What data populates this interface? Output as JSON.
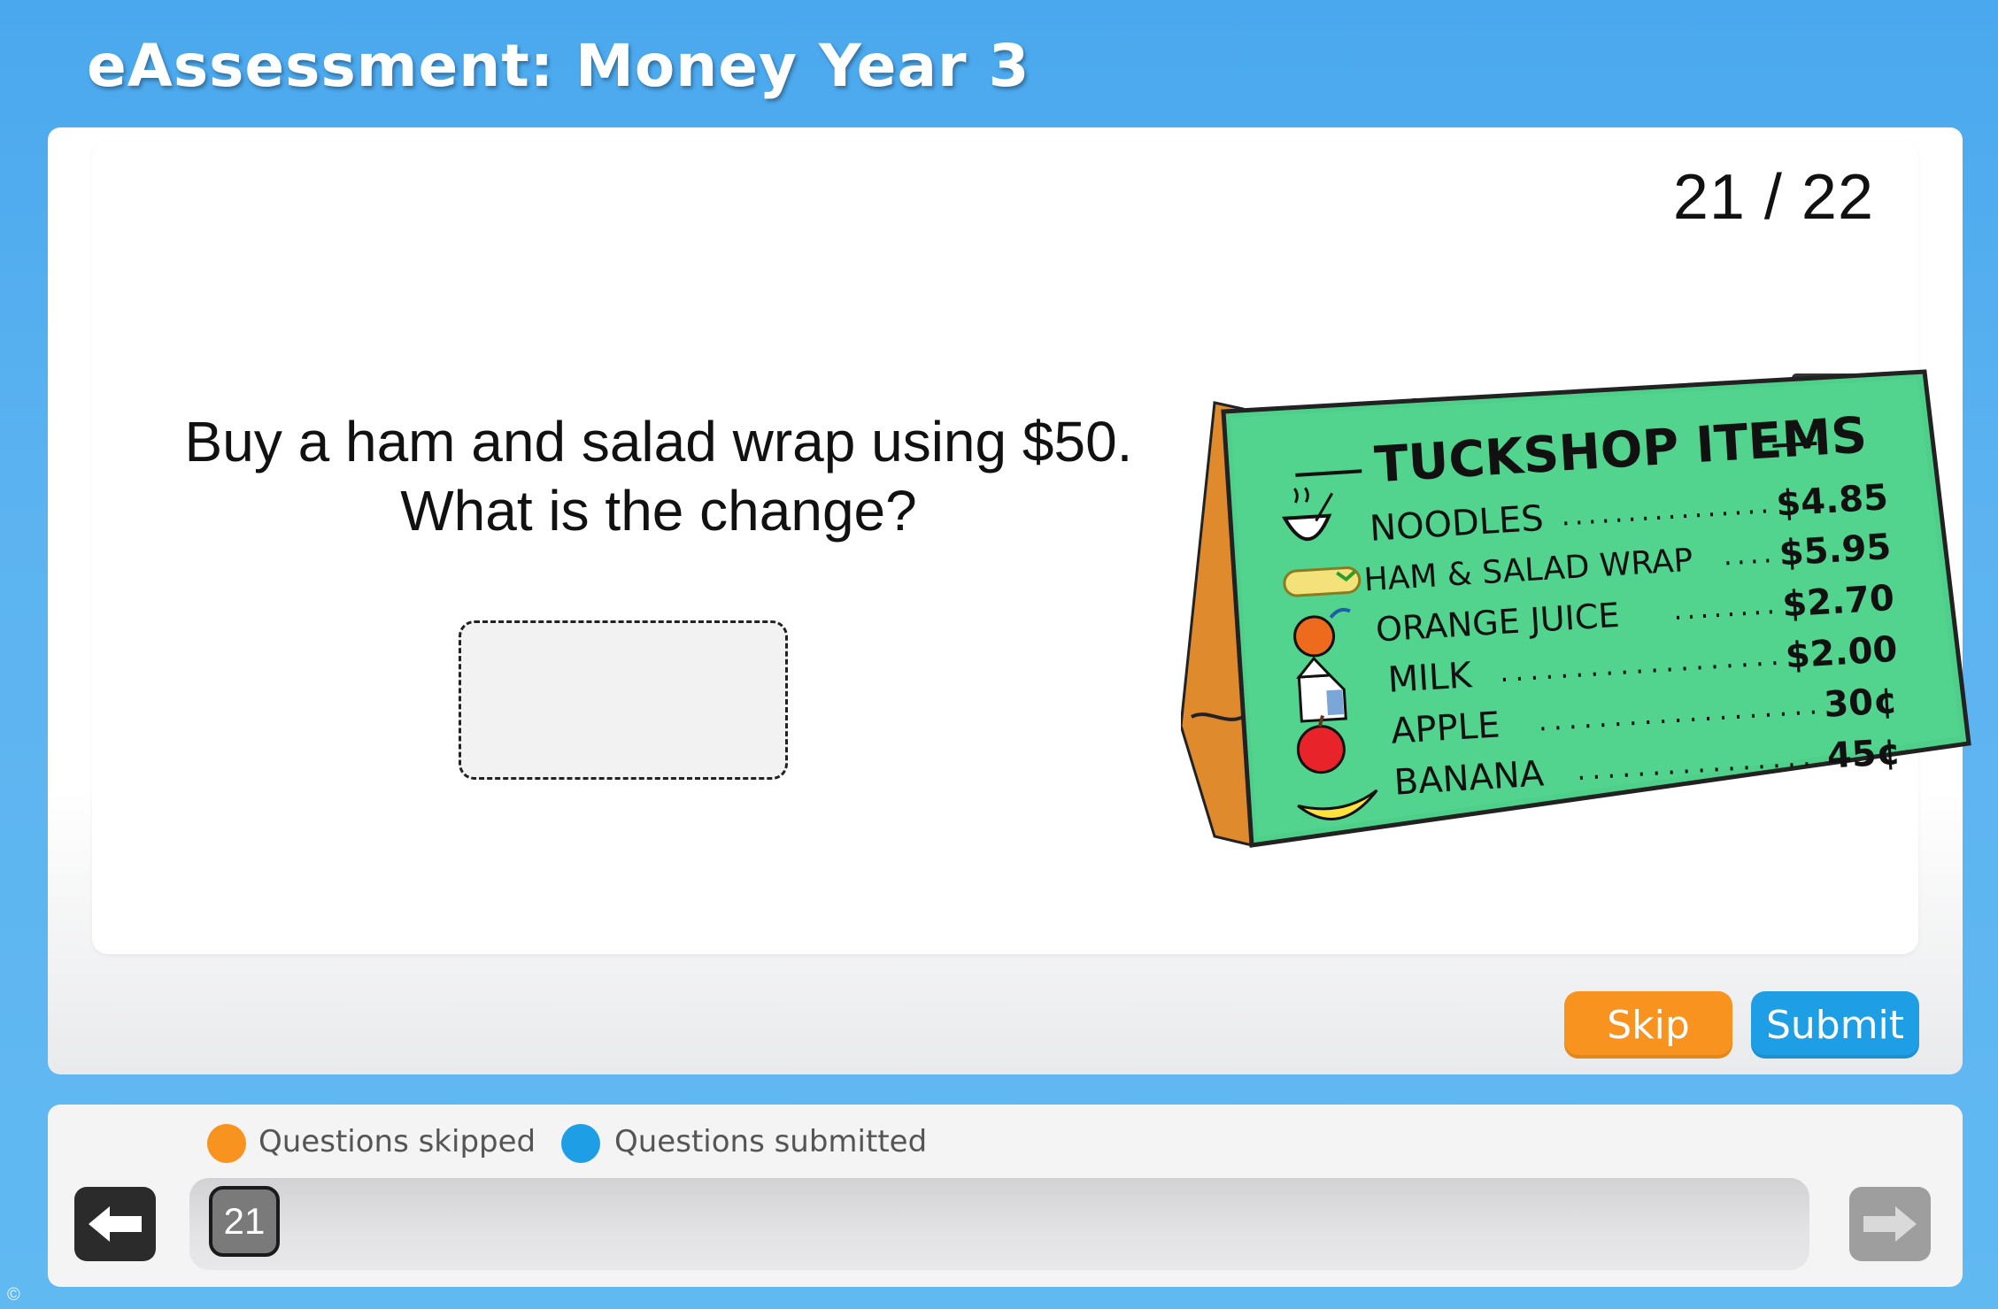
{
  "app": {
    "title": "eAssessment: Money Year 3"
  },
  "question": {
    "counter": "21 / 22",
    "line1": "Buy a ham and salad wrap using $50.",
    "line2": "What is the change?",
    "answer_value": ""
  },
  "tuckshop": {
    "heading": "TUCKSHOP ITEMS",
    "items": [
      {
        "name": "NOODLES",
        "price": "$4.85",
        "icon": "noodles-bowl-icon"
      },
      {
        "name": "HAM & SALAD WRAP",
        "price": "$5.95",
        "icon": "wrap-icon"
      },
      {
        "name": "ORANGE JUICE",
        "price": "$2.70",
        "icon": "orange-icon"
      },
      {
        "name": "MILK",
        "price": "$2.00",
        "icon": "milk-carton-icon"
      },
      {
        "name": "APPLE",
        "price": "30¢",
        "icon": "apple-icon"
      },
      {
        "name": "BANANA",
        "price": "45¢",
        "icon": "banana-icon"
      }
    ]
  },
  "actions": {
    "skip_label": "Skip",
    "submit_label": "Submit"
  },
  "legend": {
    "skipped": "Questions skipped",
    "submitted": "Questions submitted"
  },
  "navigator": {
    "current_question": "21",
    "back_icon": "arrow-left-icon",
    "forward_icon": "arrow-right-icon"
  },
  "footer": {
    "copyright": "©"
  },
  "colors": {
    "background": "#5cb3f0",
    "skip": "#f7931e",
    "submit": "#1e9ee4",
    "sign_board": "#4fd08a",
    "sign_frame": "#e08a2e"
  }
}
